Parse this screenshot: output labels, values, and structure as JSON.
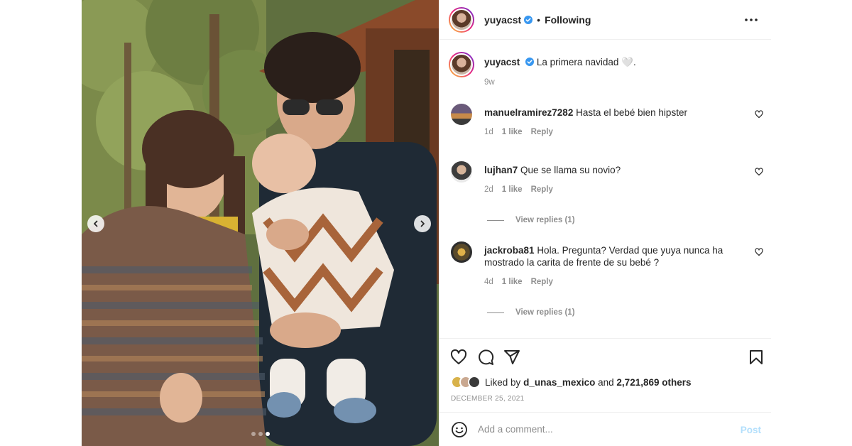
{
  "post": {
    "author": "yuyacst",
    "follow_status": "Following",
    "caption_user": "yuyacst",
    "caption_text": "La primera navidad 🤍.",
    "caption_age": "9w",
    "photo_dots": 3,
    "photo_active_dot": 3
  },
  "comments": [
    {
      "user": "manuelramirez7282",
      "text": "Hasta el bebé bien hipster",
      "age": "1d",
      "likes": "1 like",
      "reply": "Reply",
      "replies": ""
    },
    {
      "user": "lujhan7",
      "text": "Que se llama su novio?",
      "age": "2d",
      "likes": "1 like",
      "reply": "Reply",
      "replies": "View replies (1)"
    },
    {
      "user": "jackroba81",
      "text": "Hola. Pregunta? Verdad que yuya nunca ha mostrado la carita de frente de su bebé ?",
      "age": "4d",
      "likes": "1 like",
      "reply": "Reply",
      "replies": "View replies (1)"
    }
  ],
  "likes": {
    "prefix": "Liked by",
    "liker": "d_unas_mexico",
    "connector": "and",
    "others": "2,721,869 others"
  },
  "date": "DECEMBER 25, 2021",
  "add_comment": {
    "placeholder": "Add a comment...",
    "post_label": "Post"
  },
  "icons": {
    "verified": "verified-badge-icon",
    "more": "more-options-icon",
    "like": "heart-icon",
    "comment": "comment-bubble-icon",
    "share": "paper-plane-icon",
    "save": "bookmark-icon",
    "emoji": "smiley-icon"
  },
  "colors": {
    "verified_blue": "#3897f0",
    "post_disabled": "#b2dffc",
    "muted_text": "#8e8e8e"
  }
}
